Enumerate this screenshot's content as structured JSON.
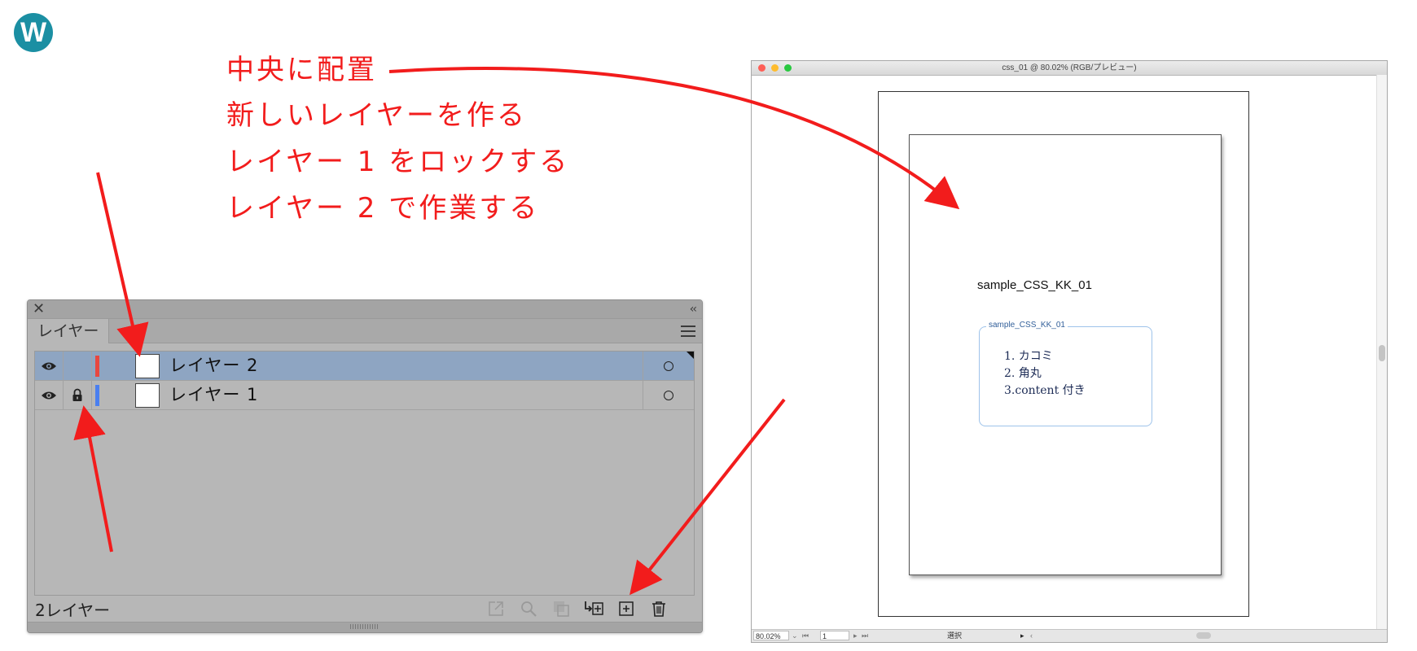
{
  "logo": {
    "letter": "W"
  },
  "annotations": [
    "中央に配置",
    "新しいレイヤーを作る",
    "レイヤー 1 をロックする",
    "レイヤー 2 で作業する"
  ],
  "layers_panel": {
    "tab_label": "レイヤー",
    "layers": [
      {
        "name": "レイヤー 2",
        "color": "#e8473f",
        "selected": true,
        "locked": false,
        "visible": true
      },
      {
        "name": "レイヤー 1",
        "color": "#4a7ff0",
        "selected": false,
        "locked": true,
        "visible": true
      }
    ],
    "status": "2レイヤー",
    "toolbar_icons": [
      "export-icon",
      "locate-object-icon",
      "clipping-mask-icon",
      "create-sublayer-icon",
      "new-layer-icon",
      "trash-icon"
    ]
  },
  "document": {
    "title": "css_01 @ 80.02% (RGB/プレビュー)",
    "zoom": "80.02%",
    "page": "1",
    "mode": "選択",
    "heading": "sample_CSS_KK_01",
    "legend": "sample_CSS_KK_01",
    "list": [
      "1. カコミ",
      "2. 角丸",
      "3.content 付き"
    ]
  },
  "colors": {
    "annotation": "#f21c1c",
    "selection": "#8ea5c2",
    "logo": "#1b8fa3"
  }
}
